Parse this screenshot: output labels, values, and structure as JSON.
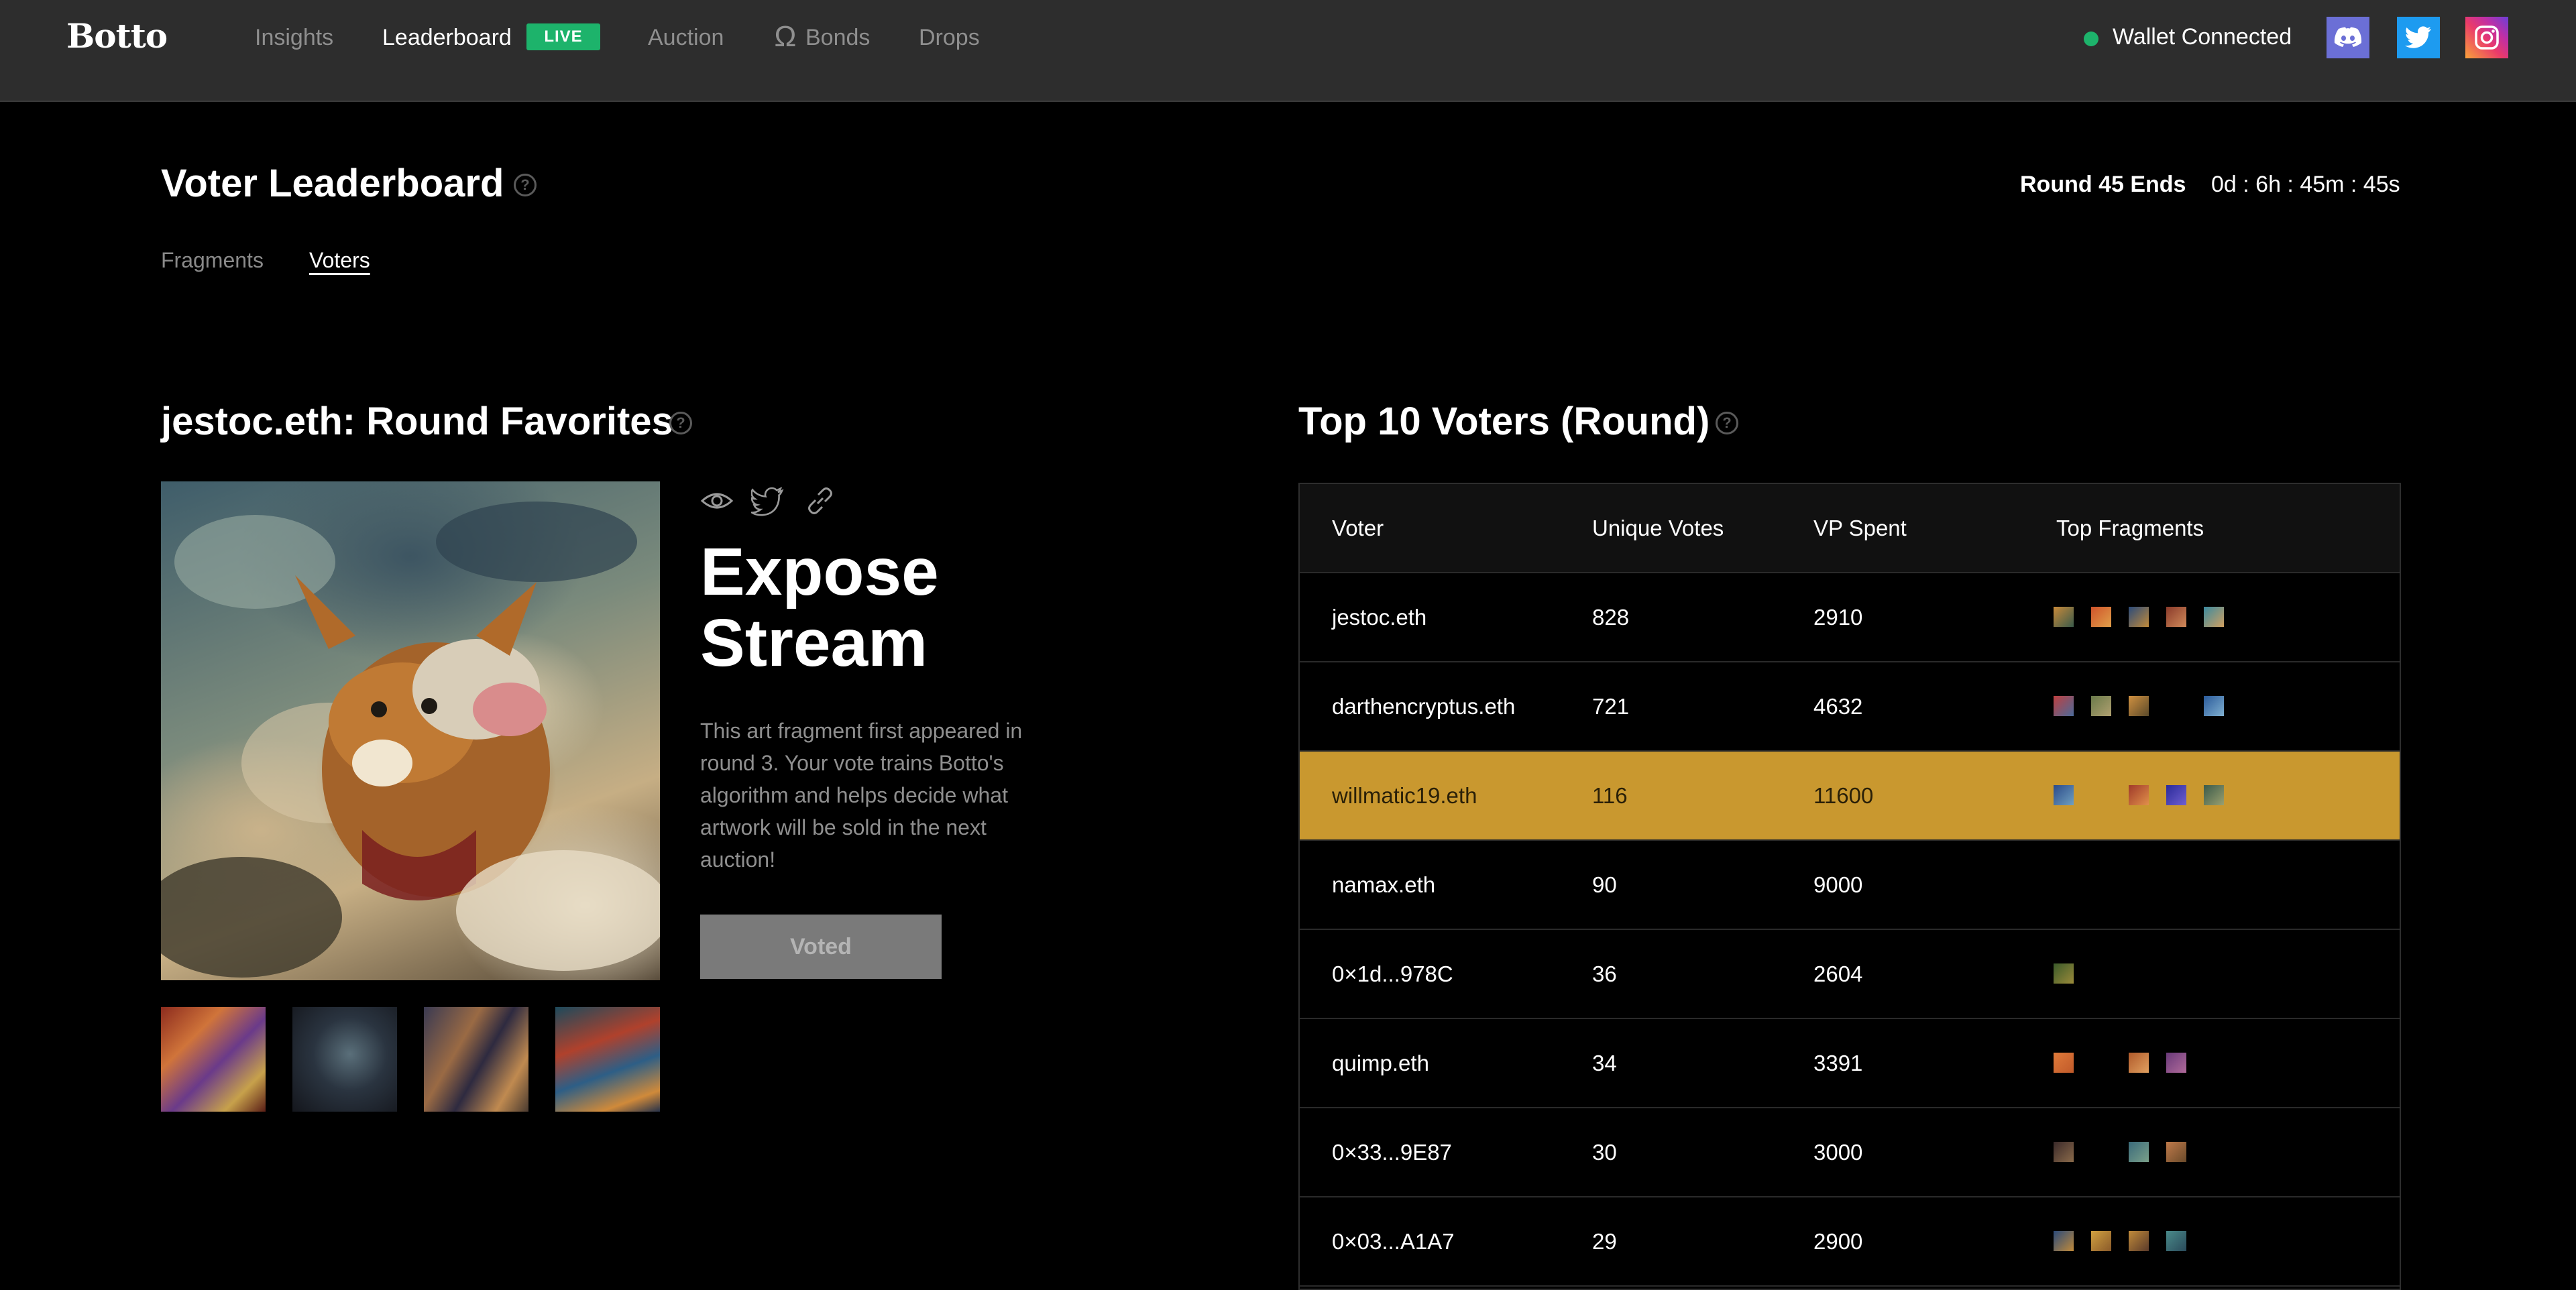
{
  "nav": {
    "logo": "Botto",
    "items": [
      "Insights",
      "Leaderboard",
      "Auction",
      "Bonds",
      "Drops"
    ],
    "live_badge": "LIVE",
    "wallet_status": "Wallet Connected",
    "social": [
      "discord-icon",
      "twitter-icon",
      "instagram-icon"
    ]
  },
  "header": {
    "title": "Voter Leaderboard",
    "round_label": "Round 45 Ends",
    "countdown": "0d : 6h : 45m : 45s",
    "tabs": [
      "Fragments",
      "Voters"
    ],
    "active_tab": "Voters"
  },
  "favorites": {
    "title": "jestoc.eth: Round Favorites",
    "art_title": "Expose Stream",
    "description": "This art fragment first appeared in round 3. Your vote trains Botto's algorithm and helps decide what artwork will be sold in the next auction!",
    "button_label": "Voted",
    "icons": [
      "eye-icon",
      "twitter-icon",
      "link-icon"
    ]
  },
  "table": {
    "title": "Top 10 Voters (Round)",
    "headers": [
      "Voter",
      "Unique Votes",
      "VP Spent",
      "Top Fragments"
    ],
    "rows": [
      {
        "voter": "jestoc.eth",
        "unique_votes": "828",
        "vp_spent": "2910"
      },
      {
        "voter": "darthencryptus.eth",
        "unique_votes": "721",
        "vp_spent": "4632"
      },
      {
        "voter": "willmatic19.eth",
        "unique_votes": "116",
        "vp_spent": "11600"
      },
      {
        "voter": "namax.eth",
        "unique_votes": "90",
        "vp_spent": "9000"
      },
      {
        "voter": "0×1d...978C",
        "unique_votes": "36",
        "vp_spent": "2604"
      },
      {
        "voter": "quimp.eth",
        "unique_votes": "34",
        "vp_spent": "3391"
      },
      {
        "voter": "0×33...9E87",
        "unique_votes": "30",
        "vp_spent": "3000"
      },
      {
        "voter": "0×03...A1A7",
        "unique_votes": "29",
        "vp_spent": "2900"
      }
    ],
    "highlighted_voter": "willmatic19.eth"
  },
  "colors": {
    "nav_bg": "#2d2d2d",
    "live_green": "#1db36b",
    "highlight_gold": "#c9982f",
    "muted_text": "#8f8f8f"
  }
}
